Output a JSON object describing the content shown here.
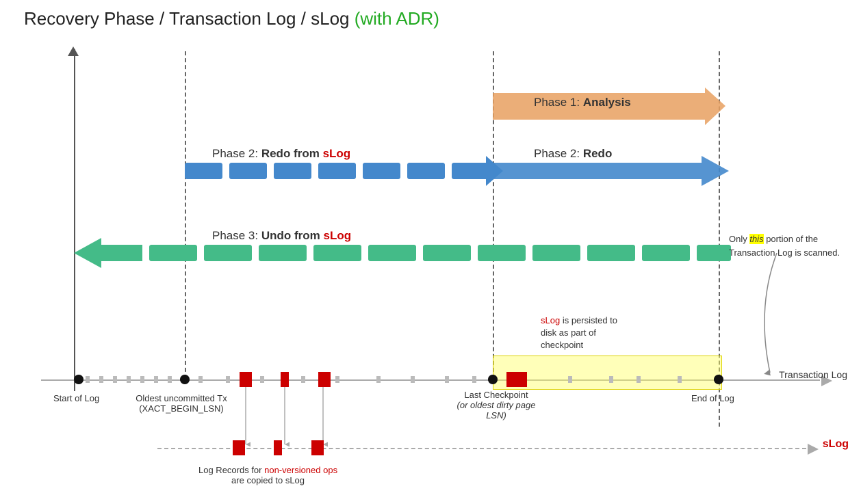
{
  "title": {
    "main": "Recovery Phase / Transaction Log / sLog",
    "highlight": " (with ADR)"
  },
  "phases": {
    "phase1": {
      "label": "Phase 1:",
      "emphasis": "Analysis"
    },
    "phase2a": {
      "label": "Phase 2:",
      "emphasis": "Redo from",
      "slog": "sLog"
    },
    "phase2b": {
      "label": "Phase 2:",
      "emphasis": "Redo"
    },
    "phase3": {
      "label": "Phase 3:",
      "emphasis": "Undo from",
      "slog": "sLog"
    }
  },
  "timeline": {
    "txLogLabel": "Transaction Log",
    "slogLabel": "sLog",
    "points": {
      "startOfLog": "Start of Log",
      "oldestTx": "Oldest uncommitted Tx\n(XACT_BEGIN_LSN)",
      "lastCheckpoint": "Last Checkpoint\n(or oldest dirty page\nLSN)",
      "endOfLog": "End of Log"
    }
  },
  "annotations": {
    "slogPersisted": "sLog is persisted to\ndisk as part of\ncheckpoint",
    "onlyThis": "Only",
    "thisWord": "this",
    "portionText": " portion of the\nTransaction Log is scanned.",
    "logRecords": "Log Records for",
    "nonVersioned": "non-versioned ops",
    "copiedTo": "are copied to sLog"
  }
}
